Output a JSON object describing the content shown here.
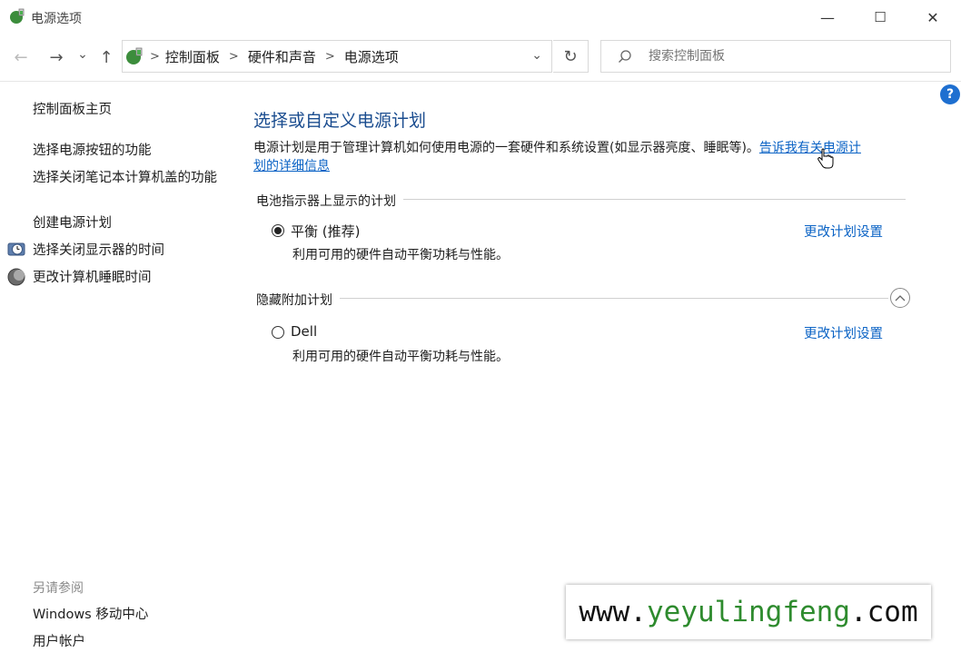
{
  "window": {
    "title": "电源选项",
    "minimize_glyph": "—",
    "maximize_glyph": "☐",
    "close_glyph": "✕"
  },
  "nav": {
    "back_glyph": "←",
    "forward_glyph": "→",
    "recent_glyph": "⌄",
    "up_glyph": "↑",
    "breadcrumb": [
      "控制面板",
      "硬件和声音",
      "电源选项"
    ],
    "refresh_glyph": "↻",
    "search_placeholder": "搜索控制面板"
  },
  "help": {
    "label": "?"
  },
  "sidebar": {
    "home": "控制面板主页",
    "items": [
      {
        "label": "选择电源按钮的功能"
      },
      {
        "label": "选择关闭笔记本计算机盖的功能"
      },
      {
        "label": "创建电源计划"
      },
      {
        "label": "选择关闭显示器的时间",
        "icon": "monitor-clock-icon"
      },
      {
        "label": "更改计算机睡眠时间",
        "icon": "moon-icon"
      }
    ],
    "see_also": {
      "title": "另请参阅",
      "items": [
        {
          "label": "Windows 移动中心"
        },
        {
          "label": "用户帐户"
        }
      ]
    }
  },
  "main": {
    "heading": "选择或自定义电源计划",
    "description": "电源计划是用于管理计算机如何使用电源的一套硬件和系统设置(如显示器亮度、睡眠等)。",
    "description_link_line1": "告诉我有关电源计",
    "description_link_line2": "划的详细信息",
    "battery_section": {
      "title": "电池指示器上显示的计划",
      "plan": {
        "name": "平衡 (推荐)",
        "selected": true,
        "description": "利用可用的硬件自动平衡功耗与性能。",
        "change_link": "更改计划设置"
      }
    },
    "hidden_section": {
      "title": "隐藏附加计划",
      "plan": {
        "name": "Dell",
        "selected": false,
        "description": "利用可用的硬件自动平衡功耗与性能。",
        "change_link": "更改计划设置"
      }
    }
  },
  "watermark": {
    "prefix": "www.",
    "name": "yeyulingfeng",
    "suffix": ".com",
    "colors": {
      "dark": "#111111",
      "green": "#2e8b2e"
    }
  },
  "colors": {
    "heading": "#1a4c8f",
    "link": "#0b63c5",
    "help": "#1e6fd0"
  }
}
